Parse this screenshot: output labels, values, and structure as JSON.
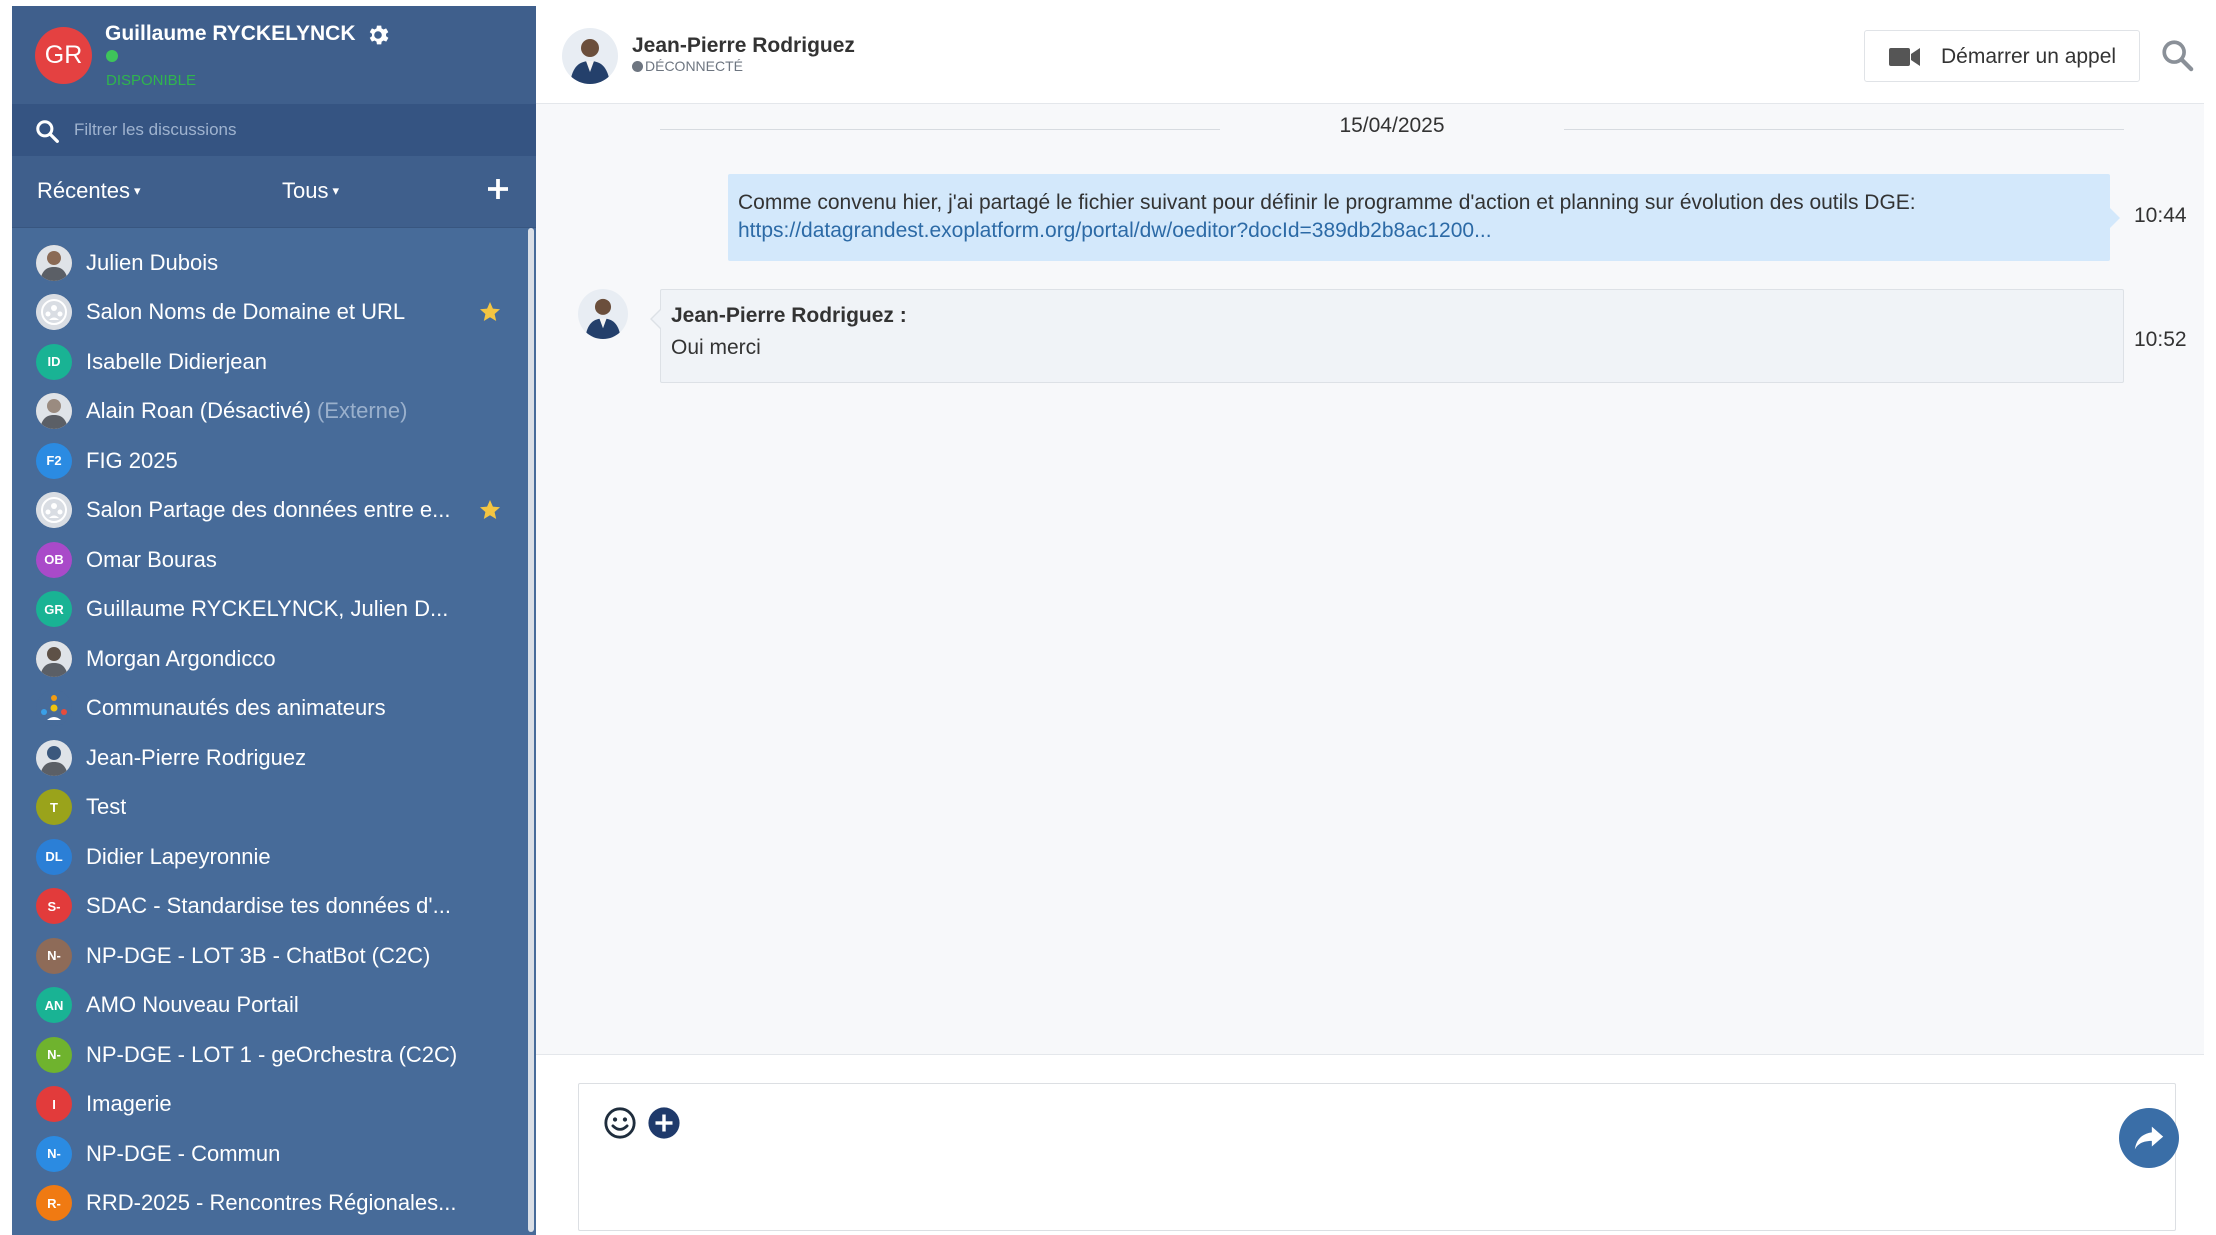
{
  "user": {
    "initials": "GR",
    "name": "Guillaume RYCKELYNCK",
    "status": "Disponible"
  },
  "sidebar": {
    "filter_placeholder": "Filtrer les discussions",
    "recent_label": "Récentes",
    "all_label": "Tous",
    "rooms": [
      {
        "name": "Julien Dubois",
        "avatar": "photo",
        "color": "#8a6a55"
      },
      {
        "name": "Salon Noms de Domaine et URL",
        "avatar": "group",
        "color": "#d9dde3",
        "starred": true
      },
      {
        "name": "Isabelle Didierjean",
        "initials": "ID",
        "color": "#19b394"
      },
      {
        "name": "Alain Roan (Désactivé)",
        "extra": "(Externe)",
        "avatar": "photo",
        "color": "#9a8b80"
      },
      {
        "name": "FIG 2025",
        "initials": "F2",
        "color": "#2b8be2"
      },
      {
        "name": "Salon Partage des données entre e...",
        "avatar": "group",
        "color": "#d9dde3",
        "starred": true
      },
      {
        "name": "Omar Bouras",
        "initials": "OB",
        "color": "#a94ac9"
      },
      {
        "name": "Guillaume RYCKELYNCK, Julien D...",
        "initials": "GR",
        "color": "#19b394"
      },
      {
        "name": "Morgan Argondicco",
        "avatar": "photo",
        "color": "#5e5147"
      },
      {
        "name": "Communautés des animateurs",
        "avatar": "community",
        "color": "#476b99"
      },
      {
        "name": "Jean-Pierre Rodriguez",
        "avatar": "photo",
        "color": "#3b587d"
      },
      {
        "name": "Test",
        "initials": "T",
        "color": "#9aa31b"
      },
      {
        "name": "Didier Lapeyronnie",
        "initials": "DL",
        "color": "#2b7fd6"
      },
      {
        "name": "SDAC - Standardise tes données d'...",
        "initials": "S-",
        "color": "#e23b3b"
      },
      {
        "name": "NP-DGE - LOT 3B - ChatBot (C2C)",
        "initials": "N-",
        "color": "#8e6b58"
      },
      {
        "name": "AMO Nouveau Portail",
        "initials": "AN",
        "color": "#19b394"
      },
      {
        "name": "NP-DGE - LOT 1 - geOrchestra (C2C)",
        "initials": "N-",
        "color": "#6fb32e"
      },
      {
        "name": "Imagerie",
        "initials": "I",
        "color": "#e23b3b"
      },
      {
        "name": "NP-DGE - Commun",
        "initials": "N-",
        "color": "#2b8be2"
      },
      {
        "name": "RRD-2025 - Rencontres Régionales...",
        "initials": "R-",
        "color": "#f07a12"
      }
    ]
  },
  "conversation": {
    "contact_name": "Jean-Pierre Rodriguez",
    "contact_status": "Déconnecté",
    "call_label": "Démarrer un appel",
    "date": "15/04/2025",
    "messages": [
      {
        "text": "Comme convenu hier, j'ai partagé le fichier suivant pour définir le programme d'action et planning sur évolution des outils DGE:",
        "link": "https://datagrandest.exoplatform.org/portal/dw/oeditor?docId=389db2b8ac1200...",
        "time": "10:44"
      },
      {
        "author": "Jean-Pierre Rodriguez :",
        "text": "Oui merci",
        "time": "10:52"
      }
    ]
  },
  "colors": {
    "sidebar": "#476b99",
    "accent": "#3a6ea7",
    "own_message": "#d3e8fb",
    "star": "#f4c542",
    "online": "#3ec55a"
  }
}
